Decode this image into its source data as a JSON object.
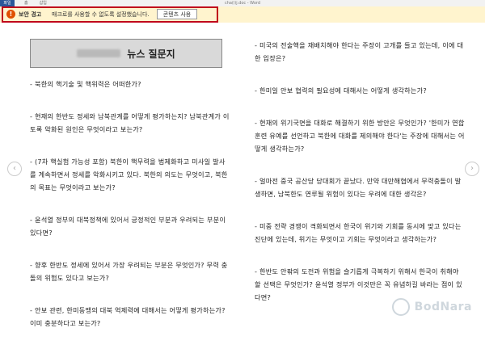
{
  "app": {
    "file_tab": "파일",
    "menu": [
      "홈",
      "삽입",
      "",
      ""
    ],
    "window_title": "cha(i)j.doc - Word"
  },
  "banner": {
    "title": "보안 경고",
    "message": "매크로를 사용할 수 없도록 설정했습니다.",
    "button": "콘텐츠 사용",
    "icon": "warning-icon"
  },
  "document": {
    "heading": "뉴스 질문지",
    "left_column": [
      "- 북한의 핵기술 및 핵위력은 어떠한가?",
      "- 현재의 한반도 정세와 남북관계를 어떻게 평가하는지? 남북관계가 이토록 악화된 원인은 무엇이라고 보는가?",
      "- (7차 핵실험 가능성 포함) 북한이 핵무력을 법제화하고 미사일 발사를 계속하면서 정세를 악화시키고 있다. 북한의 의도는 무엇이고, 북한의 목표는 무엇이라고 보는가?",
      "- 윤석열 정부의 대북정책에 있어서 긍정적인 부분과 우려되는 부분이 있다면?",
      "- 향후 한반도 정세에 있어서 가장 우려되는 부분은 무엇인가? 무력 충돌의 위험도 있다고 보는가?",
      "- 안보 관련, 한미동맹의 대북 억제력에 대해서는 어떻게 평가하는가? 이미 충분하다고 보는가?"
    ],
    "right_column": [
      "- 미국의 전술핵을 재배치해야 한다는 주장이 고개를 들고 있는데, 이에 대한 입장은?",
      "- 한미일 안보 협력의 필요성에 대해서는 어떻게 생각하는가?",
      "- 현재의 위기국면을 대화로 해결하기 위한 방안은 무엇인가? '한미가 연합훈련 유예를 선언하고 북한에 대화를 제의해야 한다'는 주장에 대해서는 어떻게 생각하는가?",
      "- 얼마전 중국 공산당 당대회가 끝났다. 만약 대만해협에서 무력충돌이 발생하면, 남북한도 연루될 위험이 있다는 우려에 대한 생각은?",
      "- 미중 전략 경쟁이 격화되면서 한국이 위기와 기회를 동시에 맞고 있다는 진단에 있는데, 위기는 무엇이고 기회는 무엇이라고 생각하는가?",
      "- 한반도 안팎의 도전과 위험을 슬기롭게 극복하기 위해서 한국이 취해야 할 선택은 무엇인가? 윤석열 정부가 이것만은 꼭 유념하길 바라는 점이 있다면?"
    ]
  },
  "watermark": {
    "text": "BodNara",
    "icon": "bodnara-logo-icon"
  },
  "nav": {
    "left_icon": "chevron-left-icon",
    "right_icon": "chevron-right-icon"
  }
}
